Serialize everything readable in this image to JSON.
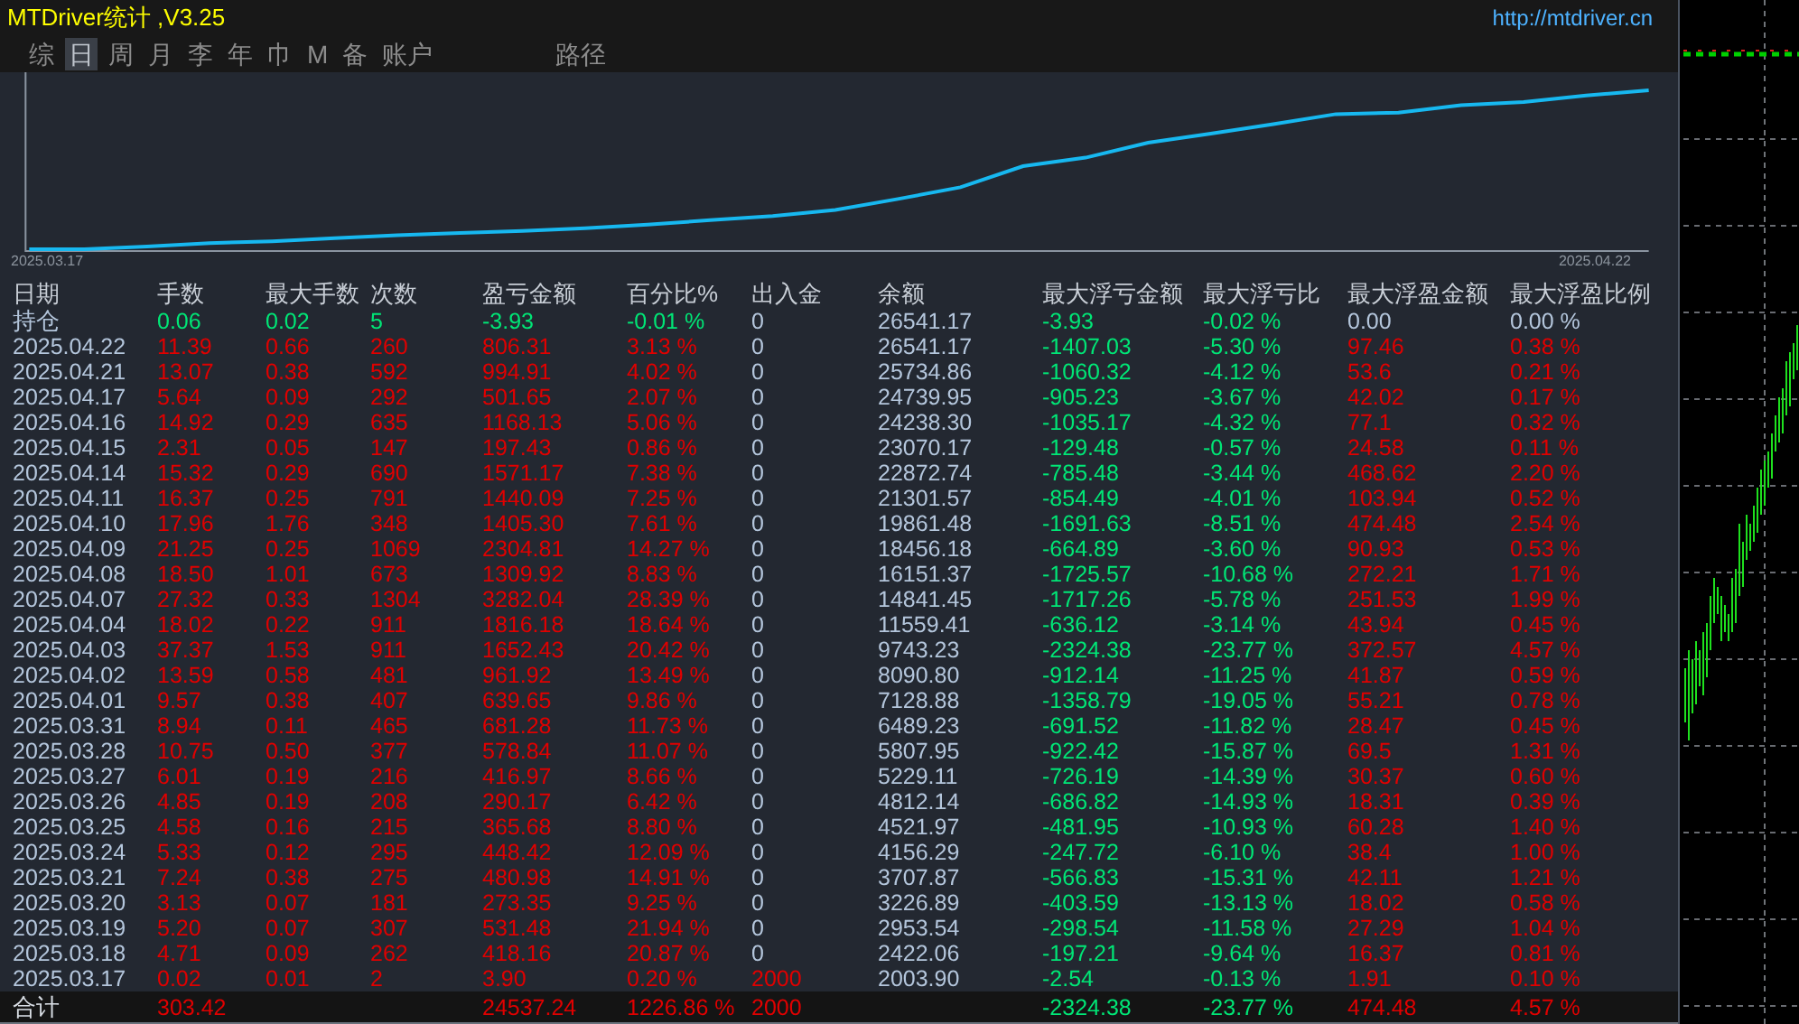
{
  "window": {
    "title": "MTDriver统计 ,V3.25",
    "link": "http://mtdriver.cn"
  },
  "tabs": [
    {
      "label": "综",
      "selected": false
    },
    {
      "label": "日",
      "selected": true
    },
    {
      "label": "周",
      "selected": false
    },
    {
      "label": "月",
      "selected": false
    },
    {
      "label": "李",
      "selected": false
    },
    {
      "label": "年",
      "selected": false
    },
    {
      "label": "巾",
      "selected": false
    },
    {
      "label": "M",
      "selected": false
    },
    {
      "label": "备",
      "selected": false
    },
    {
      "label": "账户",
      "selected": false
    },
    {
      "label": "路径",
      "selected": false
    }
  ],
  "equity_chart": {
    "start_label": "2025.03.17",
    "end_label": "2025.04.22"
  },
  "table": {
    "columns": [
      "日期",
      "手数",
      "最大手数",
      "次数",
      "盈亏金额",
      "百分比%",
      "出入金",
      "余额",
      "最大浮亏金额",
      "最大浮亏比",
      "最大浮盈金额",
      "最大浮盈比例"
    ],
    "rows": [
      {
        "kind": "holding",
        "cells": [
          "持仓",
          "0.06",
          "0.02",
          "5",
          "-3.93",
          "-0.01 %",
          "0",
          "26541.17",
          "-3.93",
          "-0.02 %",
          "0.00",
          "0.00 %"
        ]
      },
      {
        "kind": "day",
        "cells": [
          "2025.04.22",
          "11.39",
          "0.66",
          "260",
          "806.31",
          "3.13 %",
          "0",
          "26541.17",
          "-1407.03",
          "-5.30 %",
          "97.46",
          "0.38 %"
        ]
      },
      {
        "kind": "day",
        "cells": [
          "2025.04.21",
          "13.07",
          "0.38",
          "592",
          "994.91",
          "4.02 %",
          "0",
          "25734.86",
          "-1060.32",
          "-4.12 %",
          "53.6",
          "0.21 %"
        ]
      },
      {
        "kind": "day",
        "cells": [
          "2025.04.17",
          "5.64",
          "0.09",
          "292",
          "501.65",
          "2.07 %",
          "0",
          "24739.95",
          "-905.23",
          "-3.67 %",
          "42.02",
          "0.17 %"
        ]
      },
      {
        "kind": "day",
        "cells": [
          "2025.04.16",
          "14.92",
          "0.29",
          "635",
          "1168.13",
          "5.06 %",
          "0",
          "24238.30",
          "-1035.17",
          "-4.32 %",
          "77.1",
          "0.32 %"
        ]
      },
      {
        "kind": "day",
        "cells": [
          "2025.04.15",
          "2.31",
          "0.05",
          "147",
          "197.43",
          "0.86 %",
          "0",
          "23070.17",
          "-129.48",
          "-0.57 %",
          "24.58",
          "0.11 %"
        ]
      },
      {
        "kind": "day",
        "cells": [
          "2025.04.14",
          "15.32",
          "0.29",
          "690",
          "1571.17",
          "7.38 %",
          "0",
          "22872.74",
          "-785.48",
          "-3.44 %",
          "468.62",
          "2.20 %"
        ]
      },
      {
        "kind": "day",
        "cells": [
          "2025.04.11",
          "16.37",
          "0.25",
          "791",
          "1440.09",
          "7.25 %",
          "0",
          "21301.57",
          "-854.49",
          "-4.01 %",
          "103.94",
          "0.52 %"
        ]
      },
      {
        "kind": "day",
        "cells": [
          "2025.04.10",
          "17.96",
          "1.76",
          "348",
          "1405.30",
          "7.61 %",
          "0",
          "19861.48",
          "-1691.63",
          "-8.51 %",
          "474.48",
          "2.54 %"
        ]
      },
      {
        "kind": "day",
        "cells": [
          "2025.04.09",
          "21.25",
          "0.25",
          "1069",
          "2304.81",
          "14.27 %",
          "0",
          "18456.18",
          "-664.89",
          "-3.60 %",
          "90.93",
          "0.53 %"
        ]
      },
      {
        "kind": "day",
        "cells": [
          "2025.04.08",
          "18.50",
          "1.01",
          "673",
          "1309.92",
          "8.83 %",
          "0",
          "16151.37",
          "-1725.57",
          "-10.68 %",
          "272.21",
          "1.71 %"
        ]
      },
      {
        "kind": "day",
        "cells": [
          "2025.04.07",
          "27.32",
          "0.33",
          "1304",
          "3282.04",
          "28.39 %",
          "0",
          "14841.45",
          "-1717.26",
          "-5.78 %",
          "251.53",
          "1.99 %"
        ]
      },
      {
        "kind": "day",
        "cells": [
          "2025.04.04",
          "18.02",
          "0.22",
          "911",
          "1816.18",
          "18.64 %",
          "0",
          "11559.41",
          "-636.12",
          "-3.14 %",
          "43.94",
          "0.45 %"
        ]
      },
      {
        "kind": "day",
        "cells": [
          "2025.04.03",
          "37.37",
          "1.53",
          "911",
          "1652.43",
          "20.42 %",
          "0",
          "9743.23",
          "-2324.38",
          "-23.77 %",
          "372.57",
          "4.57 %"
        ]
      },
      {
        "kind": "day",
        "cells": [
          "2025.04.02",
          "13.59",
          "0.58",
          "481",
          "961.92",
          "13.49 %",
          "0",
          "8090.80",
          "-912.14",
          "-11.25 %",
          "41.87",
          "0.59 %"
        ]
      },
      {
        "kind": "day",
        "cells": [
          "2025.04.01",
          "9.57",
          "0.38",
          "407",
          "639.65",
          "9.86 %",
          "0",
          "7128.88",
          "-1358.79",
          "-19.05 %",
          "55.21",
          "0.78 %"
        ]
      },
      {
        "kind": "day",
        "cells": [
          "2025.03.31",
          "8.94",
          "0.11",
          "465",
          "681.28",
          "11.73 %",
          "0",
          "6489.23",
          "-691.52",
          "-11.82 %",
          "28.47",
          "0.45 %"
        ]
      },
      {
        "kind": "day",
        "cells": [
          "2025.03.28",
          "10.75",
          "0.50",
          "377",
          "578.84",
          "11.07 %",
          "0",
          "5807.95",
          "-922.42",
          "-15.87 %",
          "69.5",
          "1.31 %"
        ]
      },
      {
        "kind": "day",
        "cells": [
          "2025.03.27",
          "6.01",
          "0.19",
          "216",
          "416.97",
          "8.66 %",
          "0",
          "5229.11",
          "-726.19",
          "-14.39 %",
          "30.37",
          "0.60 %"
        ]
      },
      {
        "kind": "day",
        "cells": [
          "2025.03.26",
          "4.85",
          "0.19",
          "208",
          "290.17",
          "6.42 %",
          "0",
          "4812.14",
          "-686.82",
          "-14.93 %",
          "18.31",
          "0.39 %"
        ]
      },
      {
        "kind": "day",
        "cells": [
          "2025.03.25",
          "4.58",
          "0.16",
          "215",
          "365.68",
          "8.80 %",
          "0",
          "4521.97",
          "-481.95",
          "-10.93 %",
          "60.28",
          "1.40 %"
        ]
      },
      {
        "kind": "day",
        "cells": [
          "2025.03.24",
          "5.33",
          "0.12",
          "295",
          "448.42",
          "12.09 %",
          "0",
          "4156.29",
          "-247.72",
          "-6.10 %",
          "38.4",
          "1.00 %"
        ]
      },
      {
        "kind": "day",
        "cells": [
          "2025.03.21",
          "7.24",
          "0.38",
          "275",
          "480.98",
          "14.91 %",
          "0",
          "3707.87",
          "-566.83",
          "-15.31 %",
          "42.11",
          "1.21 %"
        ]
      },
      {
        "kind": "day",
        "cells": [
          "2025.03.20",
          "3.13",
          "0.07",
          "181",
          "273.35",
          "9.25 %",
          "0",
          "3226.89",
          "-403.59",
          "-13.13 %",
          "18.02",
          "0.58 %"
        ]
      },
      {
        "kind": "day",
        "cells": [
          "2025.03.19",
          "5.20",
          "0.07",
          "307",
          "531.48",
          "21.94 %",
          "0",
          "2953.54",
          "-298.54",
          "-11.58 %",
          "27.29",
          "1.04 %"
        ]
      },
      {
        "kind": "day",
        "cells": [
          "2025.03.18",
          "4.71",
          "0.09",
          "262",
          "418.16",
          "20.87 %",
          "0",
          "2422.06",
          "-197.21",
          "-9.64 %",
          "16.37",
          "0.81 %"
        ]
      },
      {
        "kind": "deposit",
        "cells": [
          "2025.03.17",
          "0.02",
          "0.01",
          "2",
          "3.90",
          "0.20 %",
          "2000",
          "2003.90",
          "-2.54",
          "-0.13 %",
          "1.91",
          "0.10 %"
        ]
      },
      {
        "kind": "total",
        "cells": [
          "合计",
          "303.42",
          null,
          null,
          "24537.24",
          "1226.86 %",
          "2000",
          null,
          "-2324.38",
          "-23.77 %",
          "474.48",
          "4.57 %"
        ]
      }
    ]
  }
}
